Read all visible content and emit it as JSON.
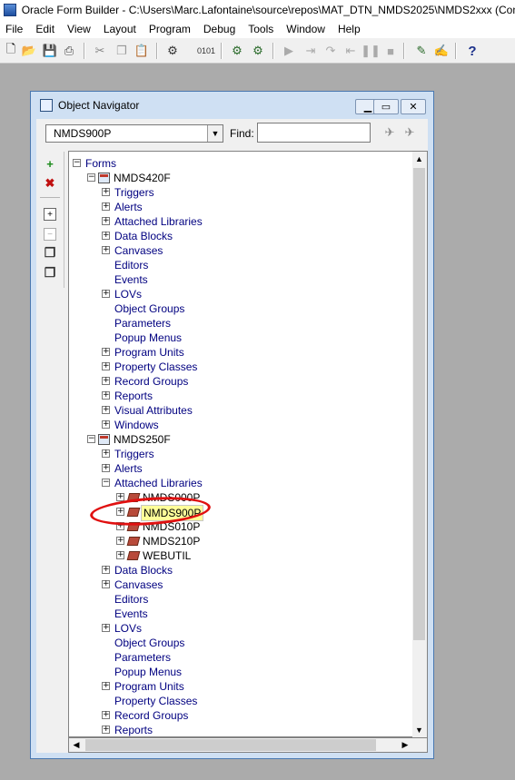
{
  "app": {
    "title": "Oracle Form Builder - C:\\Users\\Marc.Lafontaine\\source\\repos\\MAT_DTN_NMDS2025\\NMDS2xxx (Consi"
  },
  "menu": [
    "File",
    "Edit",
    "View",
    "Layout",
    "Program",
    "Debug",
    "Tools",
    "Window",
    "Help"
  ],
  "toolbar": {
    "icons": [
      "new-icon",
      "open-icon",
      "save-icon",
      "print-icon",
      "cut-icon",
      "copy-icon",
      "paste-icon",
      "compile-icon",
      "compile-module-icon",
      "run-form-icon",
      "debug-form-icon",
      "go-icon",
      "step-into-icon",
      "step-over-icon",
      "step-out-icon",
      "pause-icon",
      "stop-icon",
      "layout-editor-icon",
      "pl-sql-editor-icon",
      "help-icon"
    ]
  },
  "navigator": {
    "title": "Object Navigator",
    "module_select": "NMDS900P",
    "find_label": "Find:",
    "find_value": ""
  },
  "tree": [
    {
      "label": "Forms",
      "level": 0,
      "exp": "minus",
      "kind": "text"
    },
    {
      "label": "NMDS420F",
      "level": 1,
      "exp": "minus",
      "kind": "form"
    },
    {
      "label": "Triggers",
      "level": 2,
      "exp": "plus",
      "kind": "text"
    },
    {
      "label": "Alerts",
      "level": 2,
      "exp": "plus",
      "kind": "text"
    },
    {
      "label": "Attached Libraries",
      "level": 2,
      "exp": "plus",
      "kind": "text"
    },
    {
      "label": "Data Blocks",
      "level": 2,
      "exp": "plus",
      "kind": "text"
    },
    {
      "label": "Canvases",
      "level": 2,
      "exp": "plus",
      "kind": "text"
    },
    {
      "label": "Editors",
      "level": 2,
      "exp": "none",
      "kind": "text"
    },
    {
      "label": "Events",
      "level": 2,
      "exp": "none",
      "kind": "text"
    },
    {
      "label": "LOVs",
      "level": 2,
      "exp": "plus",
      "kind": "text"
    },
    {
      "label": "Object Groups",
      "level": 2,
      "exp": "none",
      "kind": "text"
    },
    {
      "label": "Parameters",
      "level": 2,
      "exp": "none",
      "kind": "text"
    },
    {
      "label": "Popup Menus",
      "level": 2,
      "exp": "none",
      "kind": "text"
    },
    {
      "label": "Program Units",
      "level": 2,
      "exp": "plus",
      "kind": "text"
    },
    {
      "label": "Property Classes",
      "level": 2,
      "exp": "plus",
      "kind": "text"
    },
    {
      "label": "Record Groups",
      "level": 2,
      "exp": "plus",
      "kind": "text"
    },
    {
      "label": "Reports",
      "level": 2,
      "exp": "plus",
      "kind": "text"
    },
    {
      "label": "Visual Attributes",
      "level": 2,
      "exp": "plus",
      "kind": "text"
    },
    {
      "label": "Windows",
      "level": 2,
      "exp": "plus",
      "kind": "text"
    },
    {
      "label": "NMDS250F",
      "level": 1,
      "exp": "minus",
      "kind": "form"
    },
    {
      "label": "Triggers",
      "level": 2,
      "exp": "plus",
      "kind": "text"
    },
    {
      "label": "Alerts",
      "level": 2,
      "exp": "plus",
      "kind": "text"
    },
    {
      "label": "Attached Libraries",
      "level": 2,
      "exp": "minus",
      "kind": "text"
    },
    {
      "label": "NMDS000P",
      "level": 3,
      "exp": "plus",
      "kind": "lib"
    },
    {
      "label": "NMDS900P",
      "level": 3,
      "exp": "plus",
      "kind": "lib",
      "highlight": true
    },
    {
      "label": "NMDS010P",
      "level": 3,
      "exp": "plus",
      "kind": "lib"
    },
    {
      "label": "NMDS210P",
      "level": 3,
      "exp": "plus",
      "kind": "lib"
    },
    {
      "label": "WEBUTIL",
      "level": 3,
      "exp": "plus",
      "kind": "lib"
    },
    {
      "label": "Data Blocks",
      "level": 2,
      "exp": "plus",
      "kind": "text"
    },
    {
      "label": "Canvases",
      "level": 2,
      "exp": "plus",
      "kind": "text"
    },
    {
      "label": "Editors",
      "level": 2,
      "exp": "none",
      "kind": "text"
    },
    {
      "label": "Events",
      "level": 2,
      "exp": "none",
      "kind": "text"
    },
    {
      "label": "LOVs",
      "level": 2,
      "exp": "plus",
      "kind": "text"
    },
    {
      "label": "Object Groups",
      "level": 2,
      "exp": "none",
      "kind": "text"
    },
    {
      "label": "Parameters",
      "level": 2,
      "exp": "none",
      "kind": "text"
    },
    {
      "label": "Popup Menus",
      "level": 2,
      "exp": "none",
      "kind": "text"
    },
    {
      "label": "Program Units",
      "level": 2,
      "exp": "plus",
      "kind": "text"
    },
    {
      "label": "Property Classes",
      "level": 2,
      "exp": "none",
      "kind": "text"
    },
    {
      "label": "Record Groups",
      "level": 2,
      "exp": "plus",
      "kind": "text"
    },
    {
      "label": "Reports",
      "level": 2,
      "exp": "plus",
      "kind": "text"
    }
  ],
  "colors": {
    "tree_text": "#000080",
    "annotation": "#e01010",
    "highlight": "#ffff99"
  }
}
